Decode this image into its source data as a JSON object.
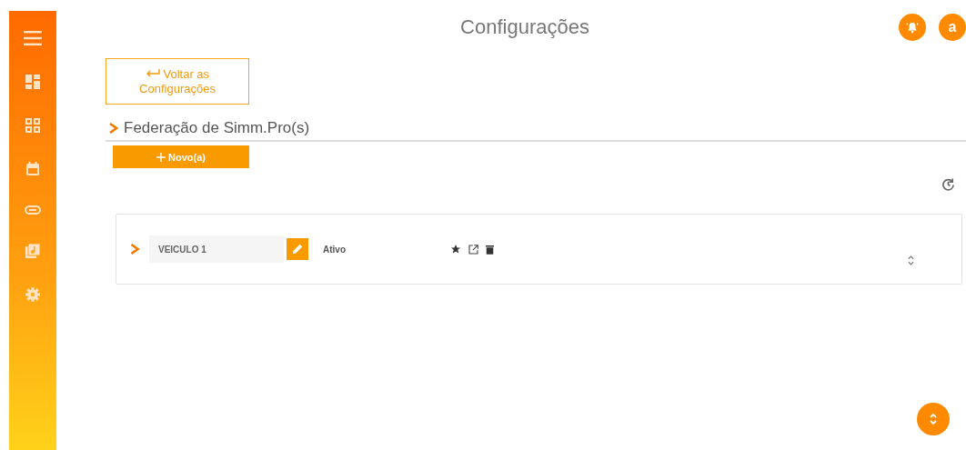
{
  "header": {
    "title": "Configurações",
    "avatar": "a"
  },
  "back_button": {
    "label": "Voltar as Configurações"
  },
  "section": {
    "title": "Federação de Simm.Pro(s)"
  },
  "new_button": {
    "label": "Novo(a)"
  },
  "items": [
    {
      "name": "VEICULO 1",
      "status": "Ativo"
    }
  ]
}
